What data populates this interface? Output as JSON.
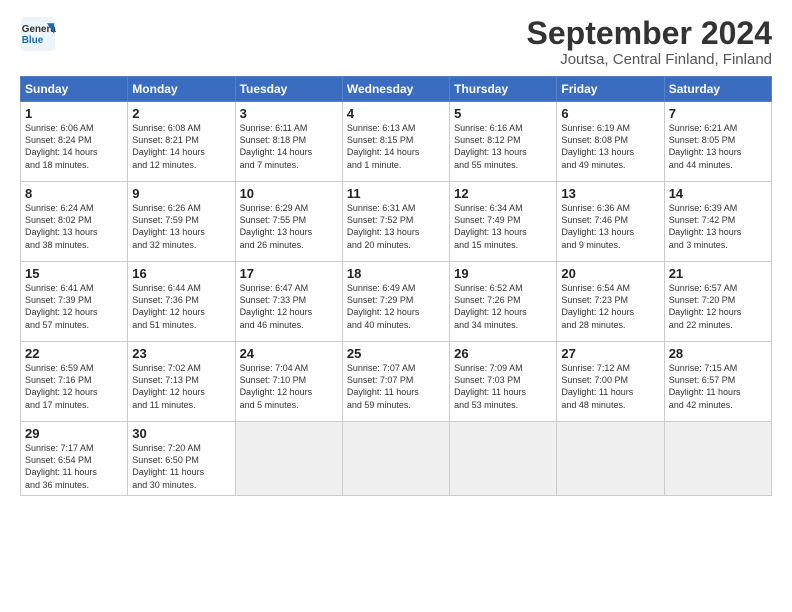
{
  "logo": {
    "general": "General",
    "blue": "Blue"
  },
  "title": "September 2024",
  "location": "Joutsa, Central Finland, Finland",
  "days_of_week": [
    "Sunday",
    "Monday",
    "Tuesday",
    "Wednesday",
    "Thursday",
    "Friday",
    "Saturday"
  ],
  "weeks": [
    [
      {
        "day": "1",
        "info": "Sunrise: 6:06 AM\nSunset: 8:24 PM\nDaylight: 14 hours\nand 18 minutes."
      },
      {
        "day": "2",
        "info": "Sunrise: 6:08 AM\nSunset: 8:21 PM\nDaylight: 14 hours\nand 12 minutes."
      },
      {
        "day": "3",
        "info": "Sunrise: 6:11 AM\nSunset: 8:18 PM\nDaylight: 14 hours\nand 7 minutes."
      },
      {
        "day": "4",
        "info": "Sunrise: 6:13 AM\nSunset: 8:15 PM\nDaylight: 14 hours\nand 1 minute."
      },
      {
        "day": "5",
        "info": "Sunrise: 6:16 AM\nSunset: 8:12 PM\nDaylight: 13 hours\nand 55 minutes."
      },
      {
        "day": "6",
        "info": "Sunrise: 6:19 AM\nSunset: 8:08 PM\nDaylight: 13 hours\nand 49 minutes."
      },
      {
        "day": "7",
        "info": "Sunrise: 6:21 AM\nSunset: 8:05 PM\nDaylight: 13 hours\nand 44 minutes."
      }
    ],
    [
      {
        "day": "8",
        "info": "Sunrise: 6:24 AM\nSunset: 8:02 PM\nDaylight: 13 hours\nand 38 minutes."
      },
      {
        "day": "9",
        "info": "Sunrise: 6:26 AM\nSunset: 7:59 PM\nDaylight: 13 hours\nand 32 minutes."
      },
      {
        "day": "10",
        "info": "Sunrise: 6:29 AM\nSunset: 7:55 PM\nDaylight: 13 hours\nand 26 minutes."
      },
      {
        "day": "11",
        "info": "Sunrise: 6:31 AM\nSunset: 7:52 PM\nDaylight: 13 hours\nand 20 minutes."
      },
      {
        "day": "12",
        "info": "Sunrise: 6:34 AM\nSunset: 7:49 PM\nDaylight: 13 hours\nand 15 minutes."
      },
      {
        "day": "13",
        "info": "Sunrise: 6:36 AM\nSunset: 7:46 PM\nDaylight: 13 hours\nand 9 minutes."
      },
      {
        "day": "14",
        "info": "Sunrise: 6:39 AM\nSunset: 7:42 PM\nDaylight: 13 hours\nand 3 minutes."
      }
    ],
    [
      {
        "day": "15",
        "info": "Sunrise: 6:41 AM\nSunset: 7:39 PM\nDaylight: 12 hours\nand 57 minutes."
      },
      {
        "day": "16",
        "info": "Sunrise: 6:44 AM\nSunset: 7:36 PM\nDaylight: 12 hours\nand 51 minutes."
      },
      {
        "day": "17",
        "info": "Sunrise: 6:47 AM\nSunset: 7:33 PM\nDaylight: 12 hours\nand 46 minutes."
      },
      {
        "day": "18",
        "info": "Sunrise: 6:49 AM\nSunset: 7:29 PM\nDaylight: 12 hours\nand 40 minutes."
      },
      {
        "day": "19",
        "info": "Sunrise: 6:52 AM\nSunset: 7:26 PM\nDaylight: 12 hours\nand 34 minutes."
      },
      {
        "day": "20",
        "info": "Sunrise: 6:54 AM\nSunset: 7:23 PM\nDaylight: 12 hours\nand 28 minutes."
      },
      {
        "day": "21",
        "info": "Sunrise: 6:57 AM\nSunset: 7:20 PM\nDaylight: 12 hours\nand 22 minutes."
      }
    ],
    [
      {
        "day": "22",
        "info": "Sunrise: 6:59 AM\nSunset: 7:16 PM\nDaylight: 12 hours\nand 17 minutes."
      },
      {
        "day": "23",
        "info": "Sunrise: 7:02 AM\nSunset: 7:13 PM\nDaylight: 12 hours\nand 11 minutes."
      },
      {
        "day": "24",
        "info": "Sunrise: 7:04 AM\nSunset: 7:10 PM\nDaylight: 12 hours\nand 5 minutes."
      },
      {
        "day": "25",
        "info": "Sunrise: 7:07 AM\nSunset: 7:07 PM\nDaylight: 11 hours\nand 59 minutes."
      },
      {
        "day": "26",
        "info": "Sunrise: 7:09 AM\nSunset: 7:03 PM\nDaylight: 11 hours\nand 53 minutes."
      },
      {
        "day": "27",
        "info": "Sunrise: 7:12 AM\nSunset: 7:00 PM\nDaylight: 11 hours\nand 48 minutes."
      },
      {
        "day": "28",
        "info": "Sunrise: 7:15 AM\nSunset: 6:57 PM\nDaylight: 11 hours\nand 42 minutes."
      }
    ],
    [
      {
        "day": "29",
        "info": "Sunrise: 7:17 AM\nSunset: 6:54 PM\nDaylight: 11 hours\nand 36 minutes."
      },
      {
        "day": "30",
        "info": "Sunrise: 7:20 AM\nSunset: 6:50 PM\nDaylight: 11 hours\nand 30 minutes."
      },
      {
        "day": "",
        "info": ""
      },
      {
        "day": "",
        "info": ""
      },
      {
        "day": "",
        "info": ""
      },
      {
        "day": "",
        "info": ""
      },
      {
        "day": "",
        "info": ""
      }
    ]
  ]
}
